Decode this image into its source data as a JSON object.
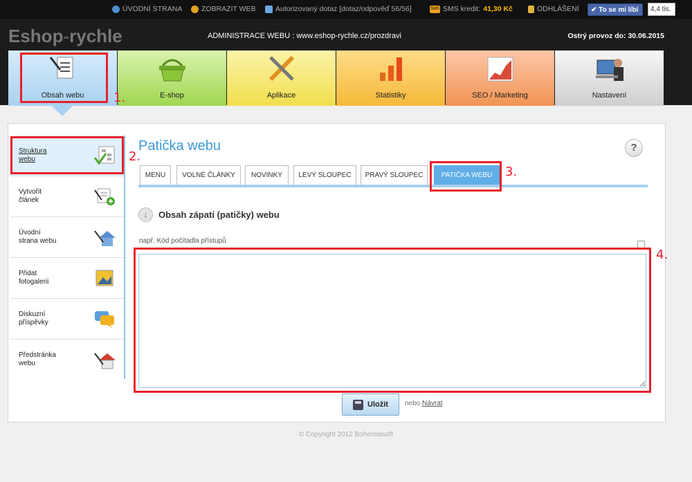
{
  "topbar": {
    "uvodni_strana": "ÚVODNÍ STRANA",
    "zobrazit_web": "ZOBRAZIT WEB",
    "autorizovany_dotaz": "Autorizovaný dotaz [dotaz/odpověď 56/56]",
    "sms_label": "SMS kredit:",
    "sms_value": "41,30 Kč",
    "odhlaseni": "ODHLÁŠENÍ",
    "like_label": "To se mi líbí",
    "like_count": "4,4 tis."
  },
  "header": {
    "logo_part1": "Eshop",
    "logo_dash": "-",
    "logo_part2": "rychle",
    "admin_text": "ADMINISTRACE WEBU : www.eshop-rychle.cz/prozdravi",
    "ostry_provoz": "Ostrý provoz do: 30.06.2015"
  },
  "main_tabs": [
    {
      "label": "Obsah webu"
    },
    {
      "label": "E-shop"
    },
    {
      "label": "Aplikace"
    },
    {
      "label": "Statistiky"
    },
    {
      "label": "SEO / Marketing"
    },
    {
      "label": "Nastavení"
    }
  ],
  "annotations": {
    "n1": "1.",
    "n2": "2.",
    "n3": "3.",
    "n4": "4."
  },
  "sidebar": {
    "items": [
      {
        "line1": "Struktura",
        "line2": "webu"
      },
      {
        "line1": "Vytvořit",
        "line2": "článek"
      },
      {
        "line1": "Úvodní",
        "line2": "strana webu"
      },
      {
        "line1": "Přidat",
        "line2": "fotogalerii"
      },
      {
        "line1": "Diskuzní",
        "line2": "příspěvky"
      },
      {
        "line1": "Předstránka",
        "line2": "webu"
      }
    ]
  },
  "page": {
    "title": "Patička webu",
    "help": "?",
    "section_title": "Obsah zápatí (patičky) webu",
    "hint": "např. Kód počítadla přístupů",
    "textarea_value": "",
    "save_label": "Uložit",
    "nebo": "nebo",
    "navrat": "Návrat"
  },
  "sub_tabs": [
    {
      "label": "MENU"
    },
    {
      "label": "VOLNÉ ČLÁNKY"
    },
    {
      "label": "NOVINKY"
    },
    {
      "label": "LEVÝ SLOUPEC"
    },
    {
      "label": "PRAVÝ SLOUPEC"
    },
    {
      "label": "PATIČKA WEBU"
    }
  ],
  "footer": {
    "copyright": "© Copyright 2012 Bohemiasoft"
  },
  "colors": {
    "accent": "#3d9ad8",
    "annotation": "#e8202a",
    "active_tab": "#5faee7"
  }
}
